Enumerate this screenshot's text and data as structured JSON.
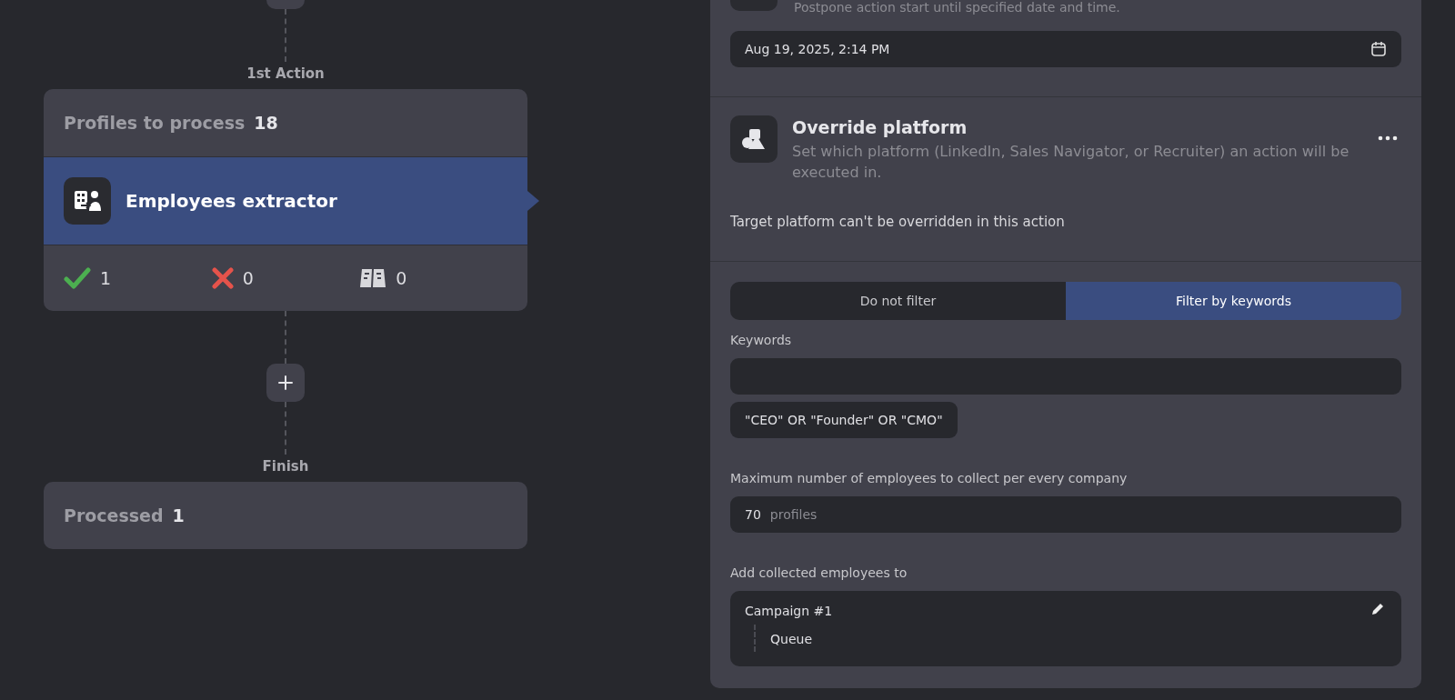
{
  "flow": {
    "stages": [
      {
        "label": "1st Action",
        "kind": "action",
        "header_label": "Profiles to process",
        "header_count": "18",
        "action_title": "Employees extractor",
        "selected": true,
        "stats": [
          {
            "kind": "success",
            "value": "1"
          },
          {
            "kind": "failed",
            "value": "0"
          },
          {
            "kind": "skipped",
            "value": "0"
          }
        ]
      },
      {
        "label": "Finish",
        "kind": "finish",
        "header_label": "Processed",
        "header_count": "1"
      }
    ]
  },
  "settings": {
    "postpone_description": "Postpone action start until specified date and time.",
    "date_field": {
      "value": "Aug 19, 2025, 2:14 PM"
    },
    "override": {
      "title": "Override platform",
      "description": "Set which platform (LinkedIn, Sales Navigator, or Recruiter) an action will be executed in.",
      "note": "Target platform can't be overridden in this action"
    },
    "filter_tabs": [
      {
        "label": "Do not filter",
        "selected": false
      },
      {
        "label": "Filter by keywords",
        "selected": true
      }
    ],
    "keywords": {
      "label": "Keywords",
      "chip": "\"CEO\" OR \"Founder\" OR \"CMO\""
    },
    "max_employees": {
      "label": "Maximum number of employees to collect per every company",
      "value": "70",
      "unit": "profiles"
    },
    "destination": {
      "label": "Add collected employees to",
      "campaign": "Campaign #1",
      "list": "Queue"
    }
  }
}
